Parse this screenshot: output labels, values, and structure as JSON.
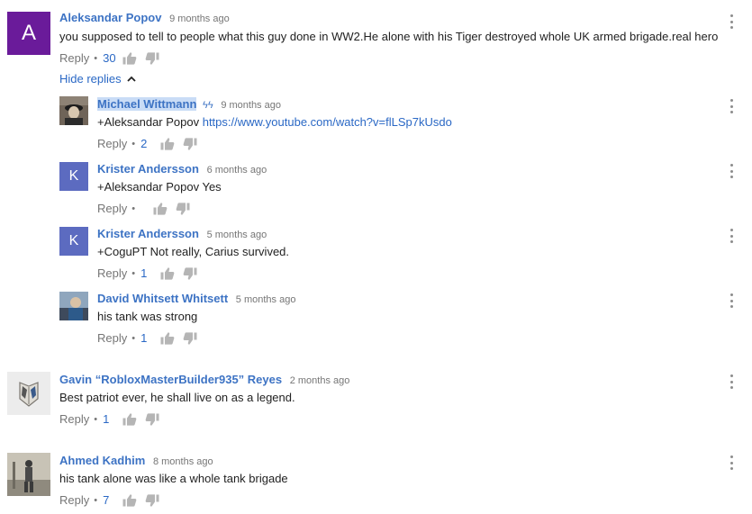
{
  "comments": [
    {
      "author": "Aleksandar Popov",
      "time": "9 months ago",
      "text": "you supposed to tell to people what this guy done in WW2.He alone with his Tiger destroyed whole UK armed brigade.real hero",
      "reply_label": "Reply",
      "likes": "30",
      "avatar_letter": "A",
      "avatar_color": "#6a1b9a"
    }
  ],
  "hide_replies_label": "Hide replies",
  "replies": [
    {
      "author": "Michael Wittmann",
      "badge": "ϟϟ",
      "time": "9 months ago",
      "text_prefix": "+Aleksandar Popov ",
      "link": "https://www.youtube.com/watch?v=flLSp7kUsdo",
      "reply_label": "Reply",
      "likes": "2",
      "avatar_icon": "photo-avatar-icon"
    },
    {
      "author": "Krister Andersson",
      "time": "6 months ago",
      "text": "+Aleksandar Popov Yes",
      "reply_label": "Reply",
      "likes": "",
      "avatar_letter": "K",
      "avatar_color": "#5c6bc0"
    },
    {
      "author": "Krister Andersson",
      "time": "5 months ago",
      "text": "+CoguPT Not really, Carius survived.",
      "reply_label": "Reply",
      "likes": "1",
      "avatar_letter": "K",
      "avatar_color": "#5c6bc0"
    },
    {
      "author": "David Whitsett Whitsett",
      "time": "5 months ago",
      "text": "his  tank was strong",
      "reply_label": "Reply",
      "likes": "1",
      "avatar_icon": "photo-avatar-icon"
    }
  ],
  "more_comments": [
    {
      "author": "Gavin “RobloxMasterBuilder935” Reyes",
      "time": "2 months ago",
      "text": "Best patriot ever, he shall live on as a legend.",
      "reply_label": "Reply",
      "likes": "1",
      "avatar_icon": "wings-emblem-icon"
    },
    {
      "author": "Ahmed Kadhim",
      "time": "8 months ago",
      "text": "his tank alone was like a whole tank brigade",
      "reply_label": "Reply",
      "likes": "7",
      "avatar_icon": "photo-avatar-icon"
    }
  ],
  "colors": {
    "author": "#3d73c4",
    "link": "#2a68c5",
    "meta": "#767676",
    "thumb": "#b5b5b5"
  }
}
